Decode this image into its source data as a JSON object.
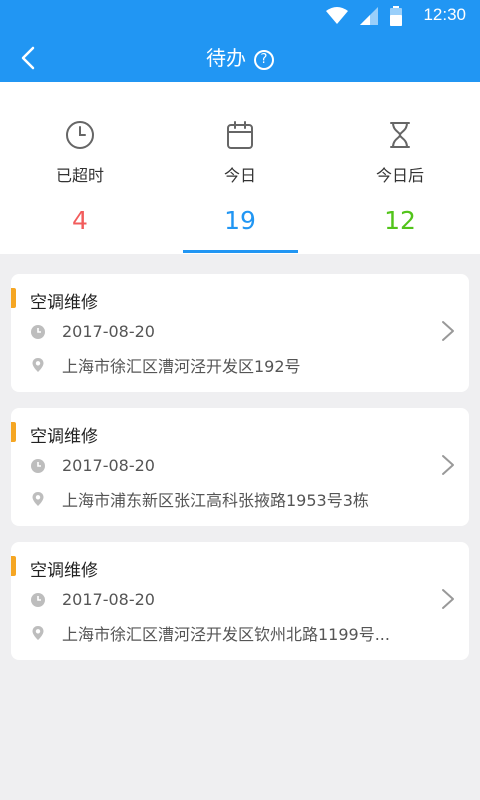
{
  "status_bar": {
    "time": "12:30",
    "icons": [
      "wifi-icon",
      "signal-icon",
      "battery-icon"
    ]
  },
  "header": {
    "title": "待办",
    "help_icon": "question-circle-icon",
    "back_icon": "chevron-left-icon"
  },
  "tabs": [
    {
      "label": "已超时",
      "count": "4",
      "icon": "clock-icon",
      "count_color": "#f25c5c"
    },
    {
      "label": "今日",
      "count": "19",
      "icon": "calendar-icon",
      "count_color": "#2196f3",
      "selected": true
    },
    {
      "label": "今日后",
      "count": "12",
      "icon": "hourglass-icon",
      "count_color": "#52c41a"
    }
  ],
  "tasks": [
    {
      "title": "空调维修",
      "date": "2017-08-20",
      "address": "上海市徐汇区漕河泾开发区192号"
    },
    {
      "title": "空调维修",
      "date": "2017-08-20",
      "address": "上海市浦东新区张江高科张掖路1953号3栋"
    },
    {
      "title": "空调维修",
      "date": "2017-08-20",
      "address": "上海市徐汇区漕河泾开发区钦州北路1199号..."
    }
  ],
  "colors": {
    "primary": "#2196f3",
    "accent": "#f5a623",
    "overdue": "#f25c5c",
    "future": "#52c41a"
  }
}
